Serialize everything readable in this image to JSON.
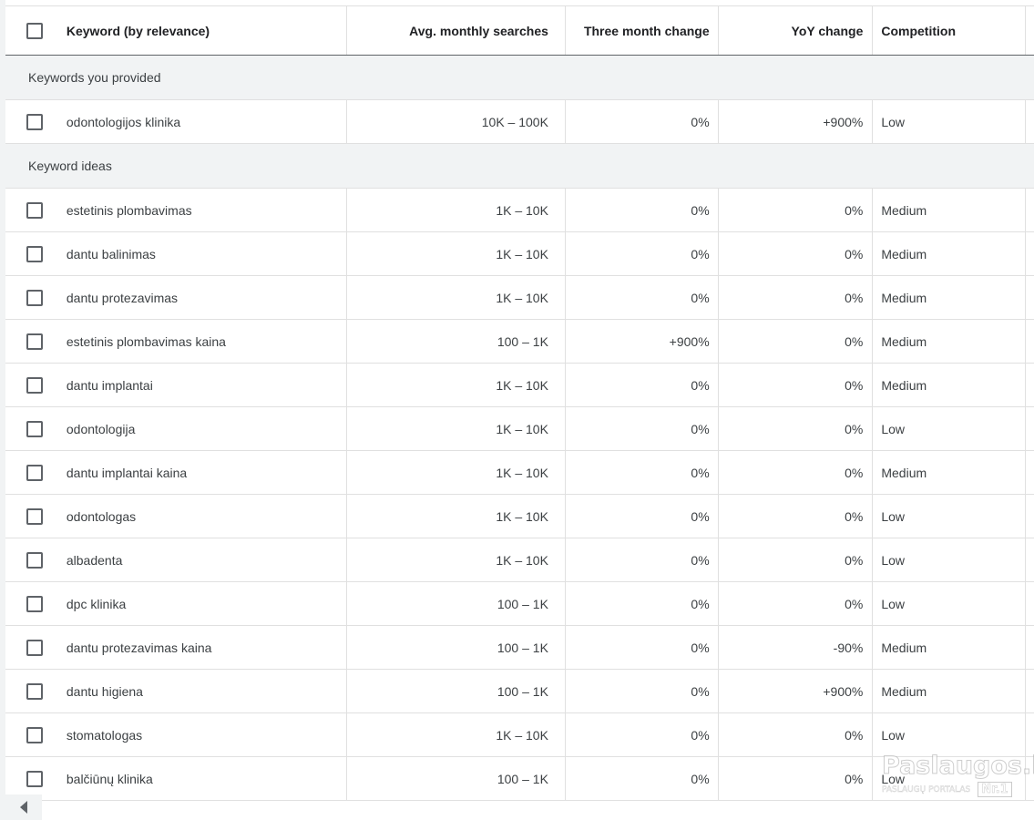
{
  "table": {
    "headers": {
      "keyword": "Keyword (by relevance)",
      "avg": "Avg. monthly searches",
      "three_month": "Three month change",
      "yoy": "YoY change",
      "competition": "Competition"
    },
    "groups": {
      "provided": "Keywords you provided",
      "ideas": "Keyword ideas"
    },
    "provided_rows": [
      {
        "keyword": "odontologijos klinika",
        "avg": "10K – 100K",
        "three_month": "0%",
        "yoy": "+900%",
        "competition": "Low"
      }
    ],
    "idea_rows": [
      {
        "keyword": "estetinis plombavimas",
        "avg": "1K – 10K",
        "three_month": "0%",
        "yoy": "0%",
        "competition": "Medium"
      },
      {
        "keyword": "dantu balinimas",
        "avg": "1K – 10K",
        "three_month": "0%",
        "yoy": "0%",
        "competition": "Medium"
      },
      {
        "keyword": "dantu protezavimas",
        "avg": "1K – 10K",
        "three_month": "0%",
        "yoy": "0%",
        "competition": "Medium"
      },
      {
        "keyword": "estetinis plombavimas kaina",
        "avg": "100 – 1K",
        "three_month": "+900%",
        "yoy": "0%",
        "competition": "Medium"
      },
      {
        "keyword": "dantu implantai",
        "avg": "1K – 10K",
        "three_month": "0%",
        "yoy": "0%",
        "competition": "Medium"
      },
      {
        "keyword": "odontologija",
        "avg": "1K – 10K",
        "three_month": "0%",
        "yoy": "0%",
        "competition": "Low"
      },
      {
        "keyword": "dantu implantai kaina",
        "avg": "1K – 10K",
        "three_month": "0%",
        "yoy": "0%",
        "competition": "Medium"
      },
      {
        "keyword": "odontologas",
        "avg": "1K – 10K",
        "three_month": "0%",
        "yoy": "0%",
        "competition": "Low"
      },
      {
        "keyword": "albadenta",
        "avg": "1K – 10K",
        "three_month": "0%",
        "yoy": "0%",
        "competition": "Low"
      },
      {
        "keyword": "dpc klinika",
        "avg": "100 – 1K",
        "three_month": "0%",
        "yoy": "0%",
        "competition": "Low"
      },
      {
        "keyword": "dantu protezavimas kaina",
        "avg": "100 – 1K",
        "three_month": "0%",
        "yoy": "-90%",
        "competition": "Medium"
      },
      {
        "keyword": "dantu higiena",
        "avg": "100 – 1K",
        "three_month": "0%",
        "yoy": "+900%",
        "competition": "Medium"
      },
      {
        "keyword": "stomatologas",
        "avg": "1K – 10K",
        "three_month": "0%",
        "yoy": "0%",
        "competition": "Low"
      },
      {
        "keyword": "balčiūnų klinika",
        "avg": "100 – 1K",
        "three_month": "0%",
        "yoy": "0%",
        "competition": "Low"
      }
    ]
  },
  "icons": {
    "checkbox": "checkbox-icon",
    "scroll_left": "chevron-left-icon"
  },
  "watermark": {
    "logo": "Paslaugos.lt",
    "subtitle": "PASLAUGŲ PORTALAS",
    "badge": "Nr.1"
  },
  "colors": {
    "group_background": "#f1f3f4",
    "border": "#e0e0e0",
    "text": "#3c4043"
  }
}
